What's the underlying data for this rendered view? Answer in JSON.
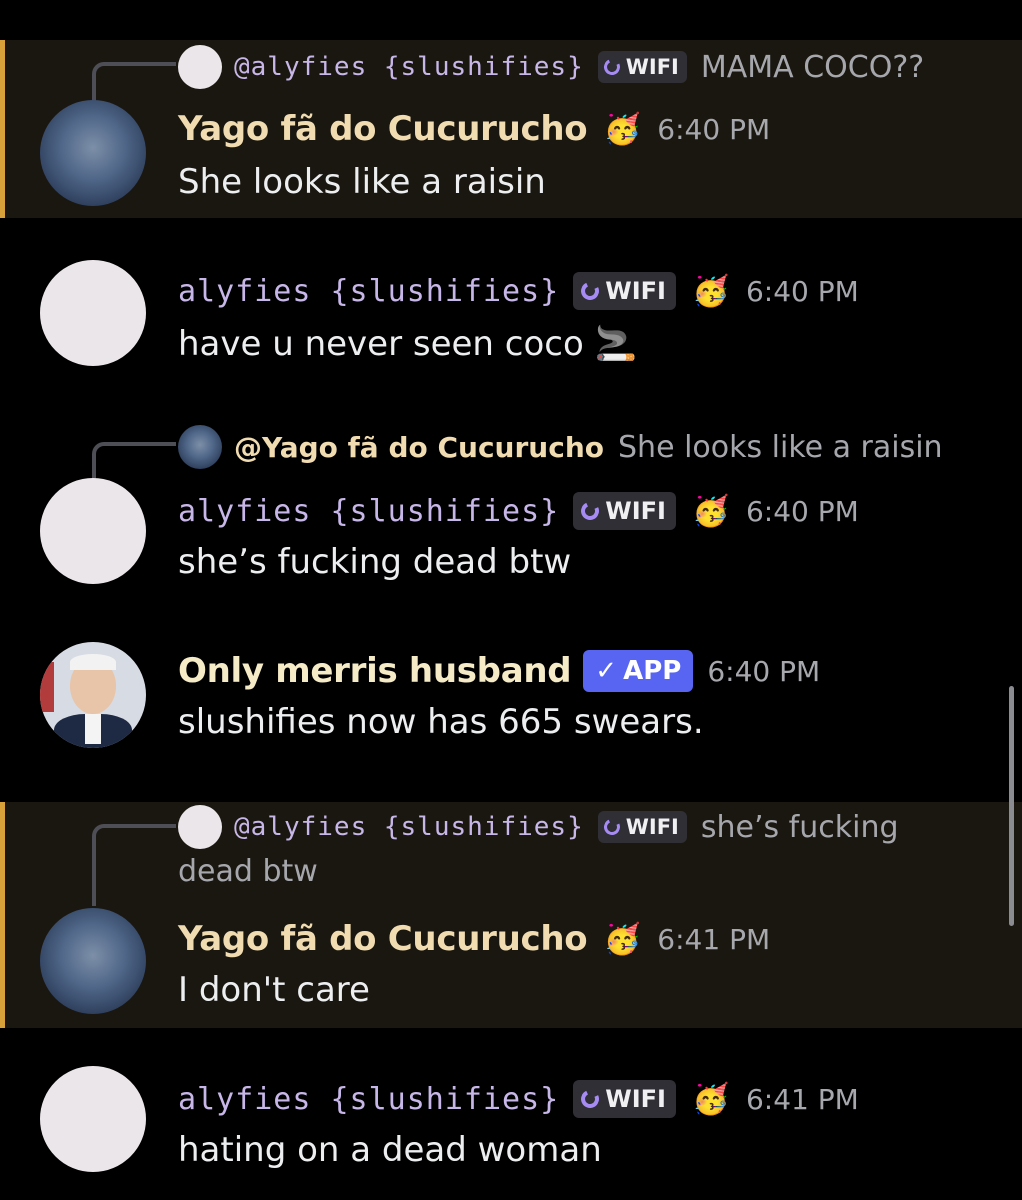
{
  "messages": [
    {
      "reply": {
        "author": "@alyfies {slushifies}",
        "tag": "WIFI",
        "text": "MAMA COCO??"
      },
      "author": "Yago fã do Cucurucho",
      "timestamp": "6:40 PM",
      "text": "She looks like a raisin"
    },
    {
      "author": "alyfies {slushifies}",
      "tag": "WIFI",
      "timestamp": "6:40 PM",
      "text": "have u never seen coco",
      "emoji": "🚬"
    },
    {
      "reply": {
        "author": "@Yago fã do Cucurucho",
        "text": "She looks like a raisin"
      },
      "author": "alyfies {slushifies}",
      "tag": "WIFI",
      "timestamp": "6:40 PM",
      "text": "she’s fucking dead btw"
    },
    {
      "author": "Only merris husband",
      "tag": "APP",
      "timestamp": "6:40 PM",
      "text": "slushifies now has 665 swears."
    },
    {
      "reply": {
        "author": "@alyfies {slushifies}",
        "tag": "WIFI",
        "text_line1": "she’s fucking",
        "text_line2": "dead btw"
      },
      "author": "Yago fã do Cucurucho",
      "timestamp": "6:41 PM",
      "text": "I don't care"
    },
    {
      "author": "alyfies {slushifies}",
      "tag": "WIFI",
      "timestamp": "6:41 PM",
      "text": "hating on a dead woman"
    }
  ],
  "icons": {
    "wifi_tag_icon": "crescent-moon-icon",
    "app_tag_icon": "checkmark-icon",
    "decoration_badge": "party-character-icon"
  },
  "colors": {
    "background": "#000000",
    "highlight_background": "#1a1710",
    "highlight_bar": "#d9a13a",
    "app_tag": "#5865f2",
    "wifi_moon": "#a68bf2",
    "yago_name": "#f1dcb2",
    "aly_name": "#c7b6e8"
  }
}
